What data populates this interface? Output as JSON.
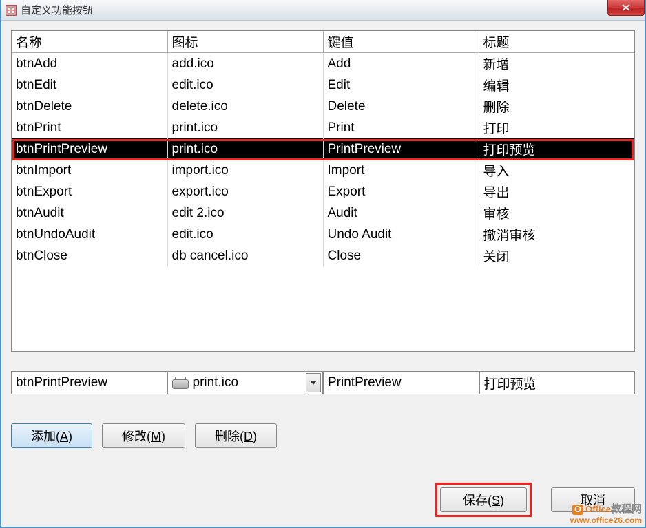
{
  "window": {
    "title": "自定义功能按钮"
  },
  "table": {
    "headers": {
      "name": "名称",
      "icon": "图标",
      "key": "键值",
      "caption": "标题"
    },
    "rows": [
      {
        "name": "btnAdd",
        "icon": "add.ico",
        "key": "Add",
        "caption": "新增",
        "selected": false
      },
      {
        "name": "btnEdit",
        "icon": "edit.ico",
        "key": "Edit",
        "caption": "编辑",
        "selected": false
      },
      {
        "name": "btnDelete",
        "icon": "delete.ico",
        "key": "Delete",
        "caption": "删除",
        "selected": false
      },
      {
        "name": "btnPrint",
        "icon": "print.ico",
        "key": "Print",
        "caption": "打印",
        "selected": false
      },
      {
        "name": "btnPrintPreview",
        "icon": "print.ico",
        "key": "PrintPreview",
        "caption": "打印预览",
        "selected": true
      },
      {
        "name": "btnImport",
        "icon": "import.ico",
        "key": "Import",
        "caption": "导入",
        "selected": false
      },
      {
        "name": "btnExport",
        "icon": "export.ico",
        "key": "Export",
        "caption": "导出",
        "selected": false
      },
      {
        "name": "btnAudit",
        "icon": "edit 2.ico",
        "key": "Audit",
        "caption": "审核",
        "selected": false
      },
      {
        "name": "btnUndoAudit",
        "icon": "edit.ico",
        "key": "Undo Audit",
        "caption": "撤消审核",
        "selected": false
      },
      {
        "name": "btnClose",
        "icon": "db cancel.ico",
        "key": "Close",
        "caption": "关闭",
        "selected": false
      }
    ]
  },
  "editor": {
    "name": "btnPrintPreview",
    "icon_text": "print.ico",
    "key": "PrintPreview",
    "caption": "打印预览"
  },
  "buttons": {
    "add": "添加(A)",
    "edit": "修改(M)",
    "delete": "删除(D)",
    "save": "保存(S)",
    "cancel": "取消"
  },
  "watermark": {
    "brand_pre": "Office",
    "brand_suf": "教程网",
    "url": "www.office26.com"
  }
}
